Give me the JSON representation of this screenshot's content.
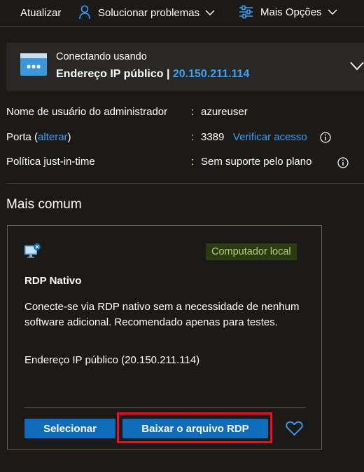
{
  "toolbar": {
    "refresh_label": "Atualizar",
    "troubleshoot_label": "Solucionar problemas",
    "more_options_label": "Mais Opções"
  },
  "connection": {
    "subtitle": "Conectando usando",
    "type_label": "Endereço IP público |",
    "ip": "20.150.211.114"
  },
  "details": {
    "admin_user_label": "Nome de usuário do administrador",
    "admin_user_value": "azureuser",
    "port_label_prefix": "Porta (",
    "port_change_link": "alterar",
    "port_label_suffix": ")",
    "port_value": "3389",
    "verify_access_link": "Verificar acesso",
    "jit_label": "Política just-in-time",
    "jit_value": "Sem suporte pelo plano",
    "separator": ":"
  },
  "section": {
    "title": "Mais comum"
  },
  "card": {
    "badge": "Computador local",
    "title": "RDP Nativo",
    "description": "Conecte-se via RDP nativo sem a necessidade de nenhum software adicional. Recomendado apenas para testes.",
    "ip_line": "Endereço IP público (20.150.211.114)",
    "select_button": "Selecionar",
    "download_button": "Baixar o arquivo RDP"
  },
  "colors": {
    "background": "#1b1a19",
    "panel": "#292827",
    "accent_link": "#3aa0f3",
    "button": "#0f6cbd",
    "badge_bg": "#2b3a13",
    "badge_text": "#b5d16a",
    "highlight": "#e81123"
  },
  "icons": {
    "refresh": "none",
    "troubleshoot": "person-wrench-icon",
    "more_options": "sliders-icon",
    "connection": "server-icon",
    "card": "monitor-connect-icon",
    "favorite": "heart-icon",
    "info": "info-icon"
  }
}
